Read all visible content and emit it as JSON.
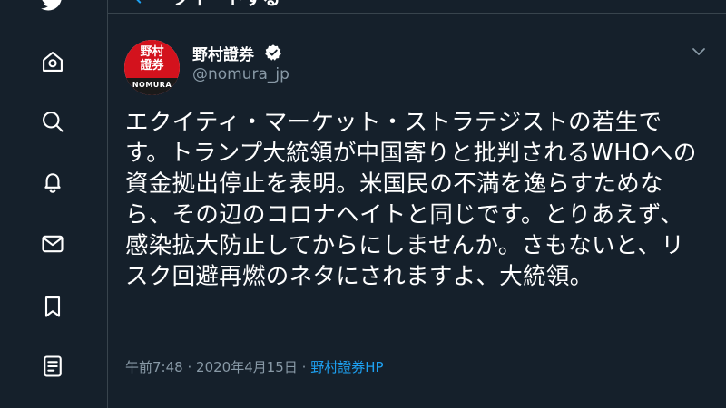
{
  "sidebar": {
    "items": [
      {
        "icon": "twitter-bird-icon"
      },
      {
        "icon": "home-icon"
      },
      {
        "icon": "search-icon"
      },
      {
        "icon": "bell-icon"
      },
      {
        "icon": "mail-icon"
      },
      {
        "icon": "bookmark-icon"
      },
      {
        "icon": "list-icon"
      }
    ]
  },
  "header": {
    "title": "ツイートする",
    "back_icon": "back-arrow-icon"
  },
  "tweet": {
    "avatar": {
      "brand_text": "野村\n證券",
      "brand_sub": "NOMURA"
    },
    "display_name": "野村證券",
    "verified_icon": "verified-badge-icon",
    "handle": "@nomura_jp",
    "menu_icon": "chevron-down-icon",
    "text": "エクイティ・マーケット・ストラテジストの若生です。トランプ大統領が中国寄りと批判されるWHOへの資金拠出停止を表明。米国民の不満を逸らすためなら、その辺のコロナヘイトと同じです。とりあえず、感染拡大防止してからにしませんか。さもないと、リスク回避再燃のネタにされますよ、大統領。",
    "time": "午前7:48",
    "separator": "·",
    "date": "2020年4月15日",
    "source": "野村證券HP"
  },
  "colors": {
    "background": "#15202b",
    "border": "#38444d",
    "text_secondary": "#8899a6",
    "accent": "#1da1f2",
    "brand_red": "#d3121d"
  }
}
